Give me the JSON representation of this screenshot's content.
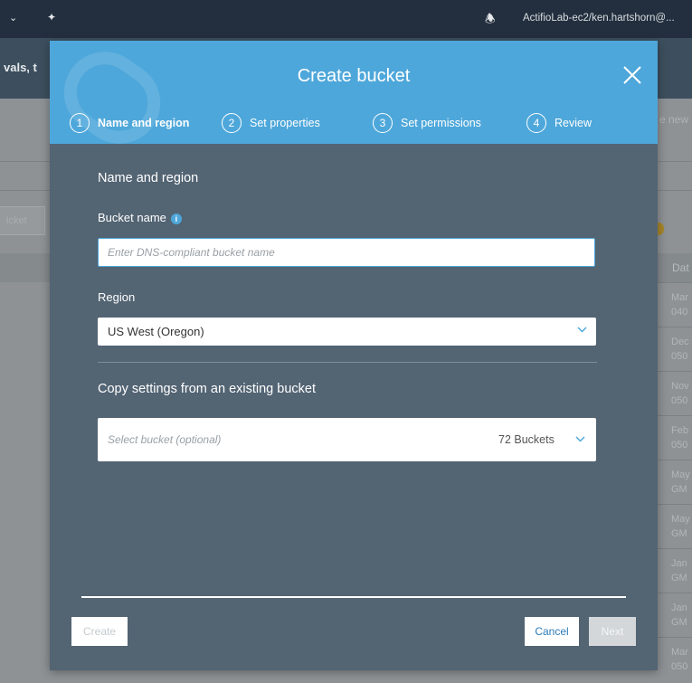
{
  "topbar": {
    "account": "ActifioLab-ec2/ken.hartshorn@..."
  },
  "background": {
    "breadcrumb_fragment": "vals, t",
    "create_button_fragment": "icket",
    "new_fragment": "e new",
    "date_header_fragment": "Dat",
    "date_rows": [
      "Mar\n040",
      "Dec\n050",
      "Nov\n050",
      "Feb\n050",
      "May\nGM",
      "May\nGM",
      "Jan\nGM",
      "Jan\nGM",
      "Mar\n050"
    ]
  },
  "modal": {
    "title": "Create bucket",
    "steps": [
      {
        "number": "1",
        "label": "Name and region",
        "active": true
      },
      {
        "number": "2",
        "label": "Set properties",
        "active": false
      },
      {
        "number": "3",
        "label": "Set permissions",
        "active": false
      },
      {
        "number": "4",
        "label": "Review",
        "active": false
      }
    ],
    "section_title": "Name and region",
    "bucket_name": {
      "label": "Bucket name",
      "placeholder": "Enter DNS-compliant bucket name",
      "value": ""
    },
    "region": {
      "label": "Region",
      "value": "US West (Oregon)"
    },
    "copy_settings": {
      "title": "Copy settings from an existing bucket",
      "placeholder": "Select bucket (optional)",
      "count": "72 Buckets"
    },
    "buttons": {
      "create": "Create",
      "cancel": "Cancel",
      "next": "Next"
    }
  },
  "colors": {
    "header_blue": "#4ea7da",
    "modal_body": "#536473",
    "cancel_text": "#2b7bb9"
  }
}
